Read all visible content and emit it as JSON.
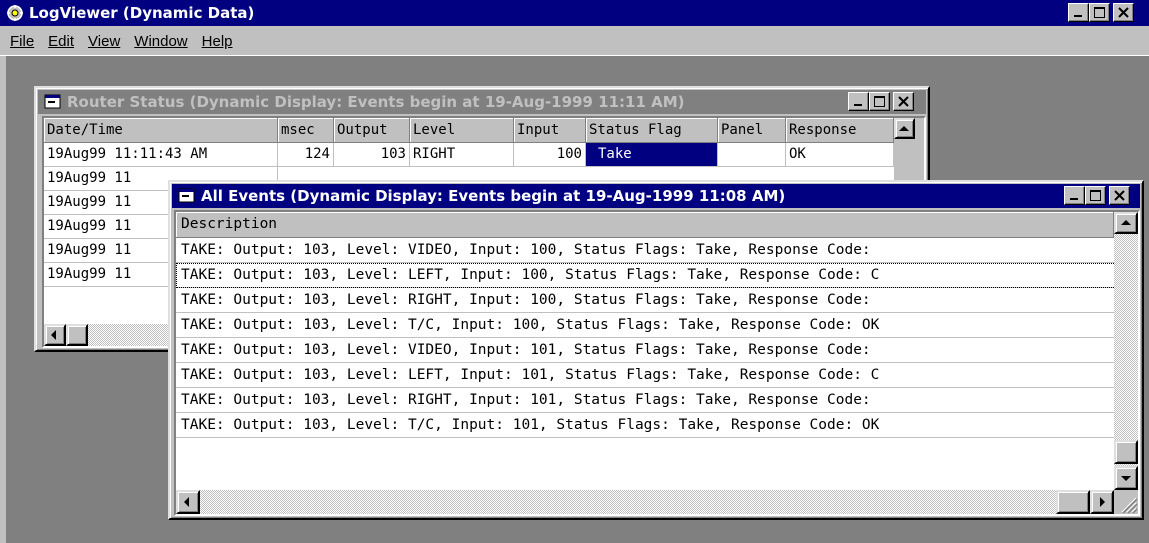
{
  "app": {
    "title": "LogViewer (Dynamic Data)",
    "menu": [
      "File",
      "Edit",
      "View",
      "Window",
      "Help"
    ]
  },
  "router_status": {
    "title": "Router Status (Dynamic Display: Events begin at 19-Aug-1999 11:11 AM)",
    "columns": [
      "Date/Time",
      "msec",
      "Output",
      "Level",
      "Input",
      "Status Flag",
      "Panel",
      "Response"
    ],
    "rows": [
      [
        "19Aug99 11:11:43 AM",
        "124",
        "103",
        "RIGHT",
        "100",
        "Take",
        "",
        "OK"
      ],
      [
        "19Aug99 11",
        "",
        "",
        "",
        "",
        "",
        "",
        ""
      ],
      [
        "19Aug99 11",
        "",
        "",
        "",
        "",
        "",
        "",
        ""
      ],
      [
        "19Aug99 11",
        "",
        "",
        "",
        "",
        "",
        "",
        ""
      ],
      [
        "19Aug99 11",
        "",
        "",
        "",
        "",
        "",
        "",
        ""
      ],
      [
        "19Aug99 11",
        "",
        "",
        "",
        "",
        "",
        "",
        ""
      ]
    ]
  },
  "all_events": {
    "title": "All Events (Dynamic Display: Events begin at 19-Aug-1999 11:08 AM)",
    "column": "Description",
    "rows": [
      "TAKE: Output: 103, Level: VIDEO, Input: 100, Status Flags:  Take, Response Code: ",
      "TAKE: Output: 103, Level: LEFT, Input: 100, Status Flags:  Take, Response Code: C",
      "TAKE: Output: 103, Level: RIGHT, Input: 100, Status Flags:  Take, Response Code: ",
      "TAKE: Output: 103, Level: T/C, Input: 100, Status Flags:  Take, Response Code: OK",
      "TAKE: Output: 103, Level: VIDEO, Input: 101, Status Flags:  Take, Response Code: ",
      "TAKE: Output: 103, Level: LEFT, Input: 101, Status Flags:  Take, Response Code: C",
      "TAKE: Output: 103, Level: RIGHT, Input: 101, Status Flags:  Take, Response Code: ",
      "TAKE: Output: 103, Level: T/C, Input: 101, Status Flags:  Take, Response Code: OK"
    ]
  },
  "colors": {
    "active_title": "#000080",
    "inactive_title": "#808080",
    "face": "#c0c0c0",
    "selection": "#000080"
  }
}
